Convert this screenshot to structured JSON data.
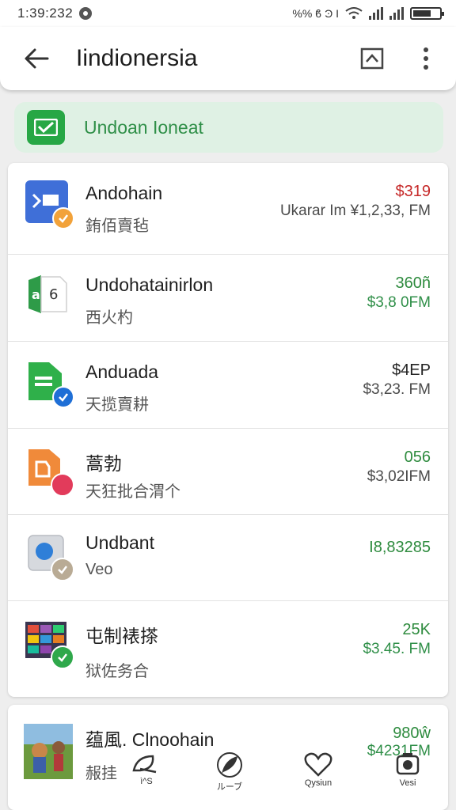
{
  "status_bar": {
    "time": "1:39:232",
    "indicators": "%% ϐ Ͽ I",
    "icons": [
      "settings-dot-icon",
      "wifi-icon",
      "signal-icon",
      "battery-icon"
    ],
    "battery_level": 0.7
  },
  "header": {
    "title": "Iindionersia",
    "back_icon": "back-arrow-icon",
    "expand_icon": "expand-icon",
    "more_icon": "more-vert-icon"
  },
  "banner": {
    "label": "Undoan Ioneat",
    "icon": "check-envelope-icon",
    "accent": "#27a745"
  },
  "transactions": [
    {
      "title": "Andohain",
      "subtitle": "銪佰賣毡",
      "amount": "$319",
      "amount_color": "#c62828",
      "time": "Ukarar Im ¥1,2,33, FM",
      "time_green": false,
      "icon": "app-blue-icon",
      "badge": "orange-check-badge"
    },
    {
      "title": "Undohatainirlon",
      "subtitle": "西火杓",
      "amount": "360ñ",
      "amount_color": "#2e8b3e",
      "time": "$3,8 0FM",
      "time_green": true,
      "icon": "app-green-doc-icon",
      "badge": ""
    },
    {
      "title": "Anduada",
      "subtitle": "天揽賣耕",
      "amount": "$4EP",
      "amount_color": "#222222",
      "time": "$3,23. FM",
      "time_green": false,
      "icon": "app-green-file-icon",
      "badge": "blue-check-badge"
    },
    {
      "title": "蒿勃",
      "subtitle": "天狂批合渭个",
      "amount": "056",
      "amount_color": "#2e8b3e",
      "time": "$3,02IFM",
      "time_green": false,
      "icon": "app-orange-icon",
      "badge": "red-dot-badge"
    },
    {
      "title": "Undbant",
      "subtitle": "Veo",
      "amount": "I8,83285",
      "amount_color": "#2e8b3e",
      "time": "",
      "time_green": false,
      "icon": "app-grey-icon",
      "badge": "grey-check-badge"
    },
    {
      "title": "屯制裱搽",
      "subtitle": "狱佐务合",
      "amount": "25K",
      "amount_color": "#2e8b3e",
      "time": "$3.45. FM",
      "time_green": true,
      "icon": "app-photo-grid-icon",
      "badge": "green-check-badge"
    }
  ],
  "bottom_item": {
    "title": "蕴風. Clnoohain",
    "subtitle": "赧挂",
    "amount": "980ŵ",
    "time": "$4231FM",
    "icon": "game-thumbnail-icon"
  },
  "bottom_nav": [
    {
      "label": "ì^S",
      "icon": "leaf-icon"
    },
    {
      "label": "ルーブ",
      "icon": "feather-icon"
    },
    {
      "label": "Qysiun",
      "icon": "heart-icon"
    },
    {
      "label": "Vesi",
      "icon": "camera-icon"
    }
  ],
  "colors": {
    "accent_green": "#2e8b3e",
    "amount_red": "#c62828",
    "banner_bg": "#dff1e4"
  }
}
